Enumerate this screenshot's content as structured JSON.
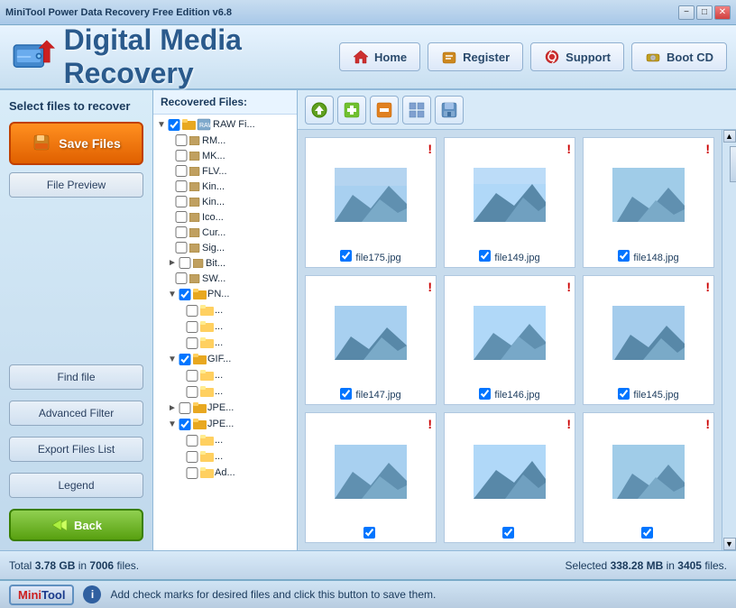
{
  "titleBar": {
    "text": "MiniTool Power Data Recovery Free Edition v6.8",
    "buttons": {
      "minimize": "−",
      "maximize": "□",
      "close": "✕"
    }
  },
  "header": {
    "appTitle": "Digital Media Recovery",
    "navButtons": [
      {
        "label": "Home",
        "icon": "home"
      },
      {
        "label": "Register",
        "icon": "register"
      },
      {
        "label": "Support",
        "icon": "support"
      },
      {
        "label": "Boot CD",
        "icon": "bootcd"
      }
    ]
  },
  "sidebar": {
    "selectLabel": "Select files to\nrecover",
    "saveFilesLabel": "Save Files",
    "filePreviewLabel": "File Preview",
    "findFileLabel": "Find file",
    "advancedFilterLabel": "Advanced Filter",
    "exportFilesListLabel": "Export Files List",
    "legendLabel": "Legend",
    "backLabel": "Back"
  },
  "fileTree": {
    "panelTitle": "Recovered Files:",
    "items": [
      {
        "indent": 0,
        "expand": "▼",
        "checked": true,
        "type": "root",
        "label": "RAW Fi..."
      },
      {
        "indent": 1,
        "expand": "",
        "checked": false,
        "type": "file",
        "label": "RM..."
      },
      {
        "indent": 1,
        "expand": "",
        "checked": false,
        "type": "file",
        "label": "MK..."
      },
      {
        "indent": 1,
        "expand": "",
        "checked": false,
        "type": "file",
        "label": "FLV..."
      },
      {
        "indent": 1,
        "expand": "",
        "checked": false,
        "type": "file",
        "label": "Kin..."
      },
      {
        "indent": 1,
        "expand": "",
        "checked": false,
        "type": "file",
        "label": "Kin..."
      },
      {
        "indent": 1,
        "expand": "",
        "checked": false,
        "type": "file",
        "label": "Ico..."
      },
      {
        "indent": 1,
        "expand": "",
        "checked": false,
        "type": "file",
        "label": "Cur..."
      },
      {
        "indent": 1,
        "expand": "",
        "checked": false,
        "type": "file",
        "label": "Sig..."
      },
      {
        "indent": 1,
        "expand": "►",
        "checked": false,
        "type": "file",
        "label": "Bit..."
      },
      {
        "indent": 1,
        "expand": "",
        "checked": false,
        "type": "file",
        "label": "SW..."
      },
      {
        "indent": 1,
        "expand": "▼",
        "checked": true,
        "type": "folder",
        "label": "PN..."
      },
      {
        "indent": 2,
        "expand": "",
        "checked": false,
        "type": "subfolder",
        "label": "..."
      },
      {
        "indent": 2,
        "expand": "",
        "checked": false,
        "type": "subfolder",
        "label": "..."
      },
      {
        "indent": 2,
        "expand": "",
        "checked": false,
        "type": "subfolder",
        "label": "..."
      },
      {
        "indent": 1,
        "expand": "▼",
        "checked": true,
        "type": "folder",
        "label": "GIF..."
      },
      {
        "indent": 2,
        "expand": "",
        "checked": false,
        "type": "subfolder",
        "label": "..."
      },
      {
        "indent": 2,
        "expand": "",
        "checked": false,
        "type": "subfolder",
        "label": "..."
      },
      {
        "indent": 1,
        "expand": "►",
        "checked": false,
        "type": "folder",
        "label": "JPE..."
      },
      {
        "indent": 1,
        "expand": "▼",
        "checked": true,
        "type": "folder",
        "label": "JPE..."
      },
      {
        "indent": 2,
        "expand": "",
        "checked": false,
        "type": "subfolder",
        "label": "..."
      },
      {
        "indent": 2,
        "expand": "",
        "checked": false,
        "type": "subfolder",
        "label": "..."
      },
      {
        "indent": 2,
        "expand": "",
        "checked": false,
        "type": "subfolder",
        "label": "Ad..."
      }
    ]
  },
  "toolbar": {
    "buttons": [
      {
        "icon": "↑",
        "label": "up"
      },
      {
        "icon": "+",
        "label": "add"
      },
      {
        "icon": "−",
        "label": "remove"
      },
      {
        "icon": "⊞",
        "label": "grid"
      },
      {
        "icon": "💾",
        "label": "save"
      }
    ]
  },
  "imageGrid": {
    "cells": [
      {
        "filename": "file175.jpg",
        "hasError": true,
        "hasCheck": true
      },
      {
        "filename": "file149.jpg",
        "hasError": true,
        "hasCheck": true
      },
      {
        "filename": "file148.jpg",
        "hasError": true,
        "hasCheck": true
      },
      {
        "filename": "file147.jpg",
        "hasError": true,
        "hasCheck": true
      },
      {
        "filename": "file146.jpg",
        "hasError": true,
        "hasCheck": true
      },
      {
        "filename": "file145.jpg",
        "hasError": true,
        "hasCheck": true
      },
      {
        "filename": "",
        "hasError": true,
        "hasCheck": true
      },
      {
        "filename": "",
        "hasError": true,
        "hasCheck": true
      },
      {
        "filename": "",
        "hasError": true,
        "hasCheck": true
      }
    ]
  },
  "statusBar": {
    "totalLabel": "Total",
    "totalSize": "3.78 GB",
    "inLabel": "in",
    "totalFiles": "7006",
    "filesLabel": "files.",
    "selectedLabel": "Selected",
    "selectedSize": "338.28 MB",
    "selectedIn": "in",
    "selectedFiles": "3405",
    "selectedFilesLabel": "files."
  },
  "bottomBar": {
    "miniLabel": "Mini",
    "toolLabel": "Tool",
    "infoText": "Add check marks for desired files and click this button to save them."
  }
}
